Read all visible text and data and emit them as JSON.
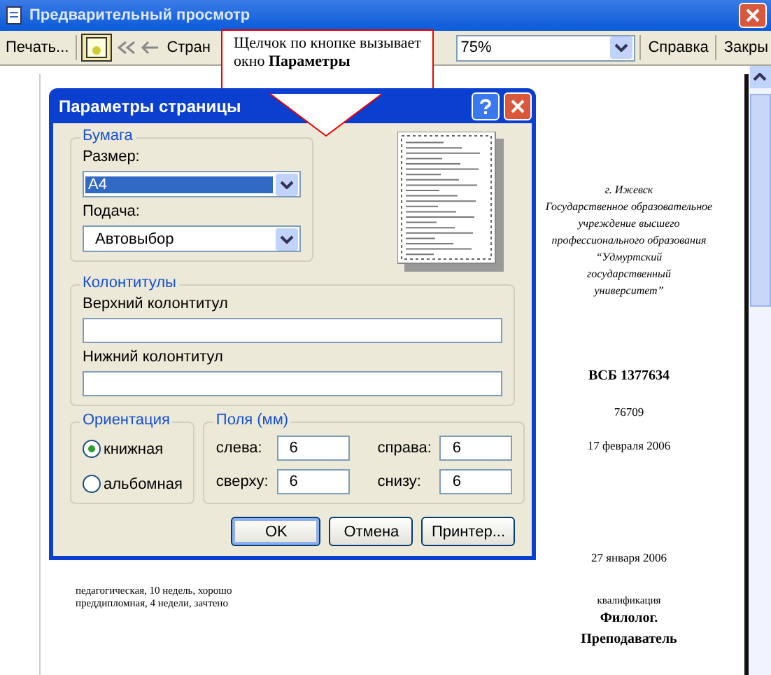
{
  "window": {
    "title": "Предварительный просмотр"
  },
  "toolbar": {
    "print_button": "Печать...",
    "page_button": "Стран",
    "zoom": "75%",
    "help_button": "Справка",
    "close_button": "Закры"
  },
  "callout": {
    "text": "Щелчок по кнопке вызывает окно **Параметры**"
  },
  "dialog": {
    "title": "Параметры страницы",
    "paper": {
      "legend": "Бумага",
      "size_label": "Размер:",
      "size_value": "A4",
      "source_label": "Подача:",
      "source_value": "Автовыбор"
    },
    "headers": {
      "legend": "Колонтитулы",
      "header_label": "Верхний колонтитул",
      "footer_label": "Нижний колонтитул"
    },
    "orientation": {
      "legend": "Ориентация",
      "options": [
        {
          "label": "книжная",
          "selected": true
        },
        {
          "label": "альбомная",
          "selected": false
        }
      ]
    },
    "margins": {
      "legend": "Поля (мм)",
      "fields": [
        {
          "label": "слева:",
          "value": "6"
        },
        {
          "label": "справа:",
          "value": "6"
        },
        {
          "label": "сверху:",
          "value": "6"
        },
        {
          "label": "снизу:",
          "value": "6"
        }
      ]
    },
    "buttons": [
      {
        "label": "OK",
        "default": true
      },
      {
        "label": "Отмена",
        "default": false
      },
      {
        "label": "Принтер...",
        "default": false
      }
    ]
  },
  "document": {
    "address": [
      "г. Ижевск",
      "Государственное образовательное",
      "учреждение высшего",
      "профессионального образования",
      "“Удмуртский",
      "государственный",
      "университет”"
    ],
    "number": "ВСБ 1377634",
    "reg_number": "76709",
    "date": "17 февраля 2006",
    "date_2": "27 января 2006",
    "practice": [
      "педагогическая, 10 недель, хорошо",
      "преддипломная, 4 недели, зачтено"
    ],
    "qualification_label": "квалификация",
    "qualification": [
      "Филолог.",
      "Преподаватель"
    ]
  }
}
